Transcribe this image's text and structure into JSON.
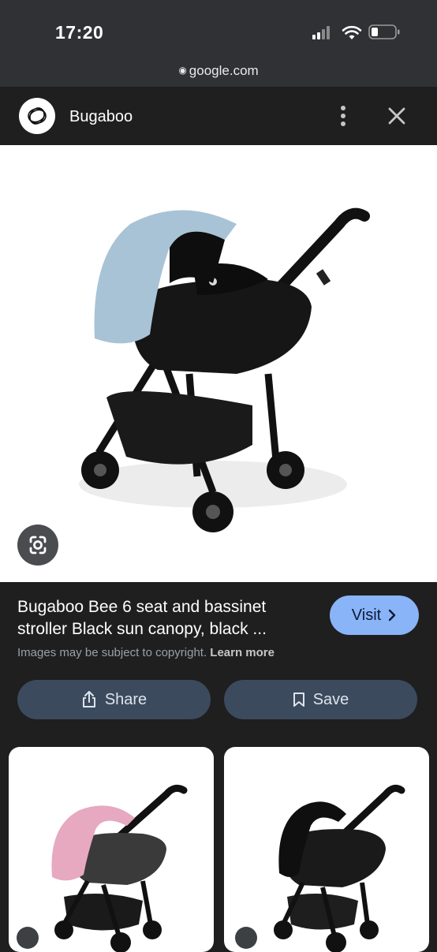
{
  "status_bar": {
    "time": "17:20"
  },
  "browser": {
    "url": "google.com"
  },
  "header": {
    "site_name": "Bugaboo"
  },
  "result": {
    "title": "Bugaboo Bee 6 seat and bassinet stroller Black sun canopy, black ...",
    "visit_label": "Visit",
    "copyright_text": "Images may be subject to copyright.",
    "learn_more": "Learn more"
  },
  "actions": {
    "share_label": "Share",
    "save_label": "Save"
  },
  "colors": {
    "background": "#1f1f1f",
    "visit_button": "#8ab4f8",
    "action_button": "#3c4a5e",
    "canopy_blue": "#a9c3d6",
    "canopy_pink": "#e7a9c0"
  },
  "icons": {
    "lock": "lock-icon",
    "more": "more-vert-icon",
    "close": "close-icon",
    "lens": "google-lens-icon",
    "share": "share-icon",
    "save": "bookmark-icon"
  }
}
